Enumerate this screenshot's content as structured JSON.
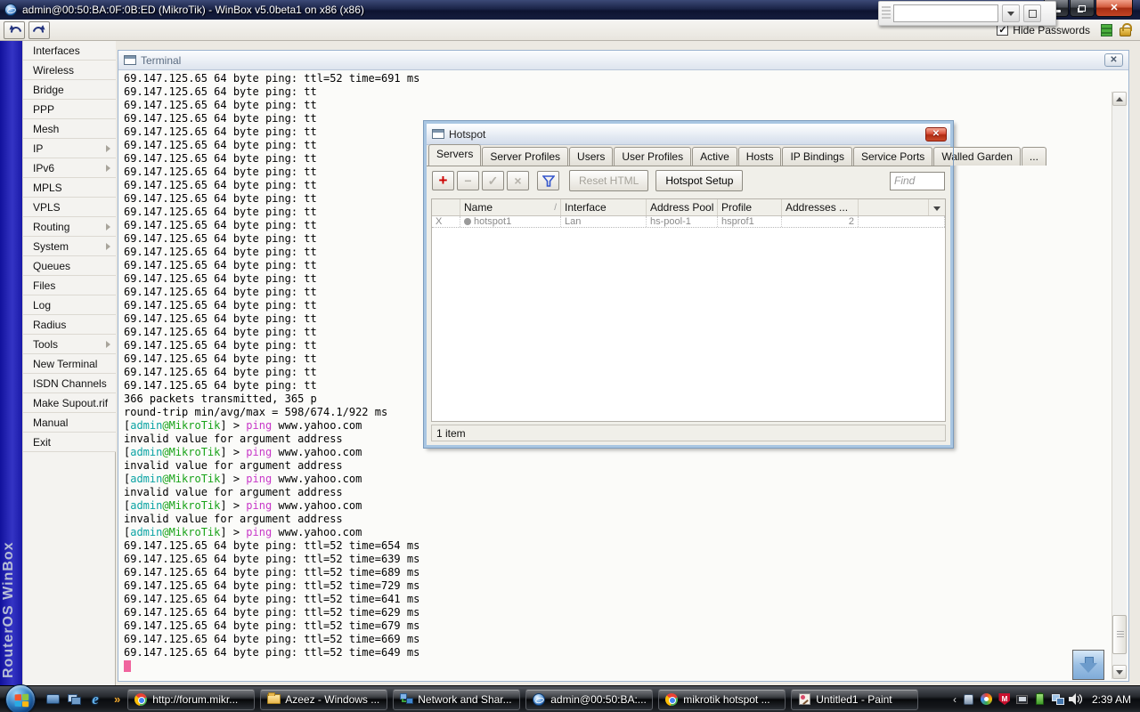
{
  "window": {
    "title": "admin@00:50:BA:0F:0B:ED (MikroTik) - WinBox v5.0beta1 on x86 (x86)"
  },
  "toolbar": {
    "hide_passwords_label": "Hide Passwords"
  },
  "sidebar": {
    "brand": "RouterOS WinBox",
    "items": [
      {
        "label": "Interfaces",
        "submenu": false
      },
      {
        "label": "Wireless",
        "submenu": false
      },
      {
        "label": "Bridge",
        "submenu": false
      },
      {
        "label": "PPP",
        "submenu": false
      },
      {
        "label": "Mesh",
        "submenu": false
      },
      {
        "label": "IP",
        "submenu": true
      },
      {
        "label": "IPv6",
        "submenu": true
      },
      {
        "label": "MPLS",
        "submenu": false
      },
      {
        "label": "VPLS",
        "submenu": false
      },
      {
        "label": "Routing",
        "submenu": true
      },
      {
        "label": "System",
        "submenu": true
      },
      {
        "label": "Queues",
        "submenu": false
      },
      {
        "label": "Files",
        "submenu": false
      },
      {
        "label": "Log",
        "submenu": false
      },
      {
        "label": "Radius",
        "submenu": false
      },
      {
        "label": "Tools",
        "submenu": true
      },
      {
        "label": "New Terminal",
        "submenu": false
      },
      {
        "label": "ISDN Channels",
        "submenu": false
      },
      {
        "label": "Make Supout.rif",
        "submenu": false
      },
      {
        "label": "Manual",
        "submenu": false
      },
      {
        "label": "Exit",
        "submenu": false
      }
    ]
  },
  "terminal": {
    "title": "Terminal",
    "prompt": {
      "open": "[",
      "user": "admin",
      "host": "@MikroTik",
      "close": "] > ",
      "command": "ping",
      "args": " www.yahoo.com"
    },
    "lines": [
      {
        "k": "plain",
        "text": "69.147.125.65 64 byte ping: ttl=52 time=691 ms"
      },
      {
        "k": "plain",
        "text": "69.147.125.65 64 byte ping: tt",
        "repeat": 23
      },
      {
        "k": "plain",
        "text": "366 packets transmitted, 365 p"
      },
      {
        "k": "plain",
        "text": "round-trip min/avg/max = 598/674.1/922 ms"
      },
      {
        "k": "prompt"
      },
      {
        "k": "plain",
        "text": "invalid value for argument address"
      },
      {
        "k": "prompt"
      },
      {
        "k": "plain",
        "text": "invalid value for argument address"
      },
      {
        "k": "prompt"
      },
      {
        "k": "plain",
        "text": "invalid value for argument address"
      },
      {
        "k": "prompt"
      },
      {
        "k": "plain",
        "text": "invalid value for argument address"
      },
      {
        "k": "prompt"
      },
      {
        "k": "plain",
        "text": "69.147.125.65 64 byte ping: ttl=52 time=654 ms"
      },
      {
        "k": "plain",
        "text": "69.147.125.65 64 byte ping: ttl=52 time=639 ms"
      },
      {
        "k": "plain",
        "text": "69.147.125.65 64 byte ping: ttl=52 time=689 ms"
      },
      {
        "k": "plain",
        "text": "69.147.125.65 64 byte ping: ttl=52 time=729 ms"
      },
      {
        "k": "plain",
        "text": "69.147.125.65 64 byte ping: ttl=52 time=641 ms"
      },
      {
        "k": "plain",
        "text": "69.147.125.65 64 byte ping: ttl=52 time=629 ms"
      },
      {
        "k": "plain",
        "text": "69.147.125.65 64 byte ping: ttl=52 time=679 ms"
      },
      {
        "k": "plain",
        "text": "69.147.125.65 64 byte ping: ttl=52 time=669 ms"
      },
      {
        "k": "plain",
        "text": "69.147.125.65 64 byte ping: ttl=52 time=649 ms"
      },
      {
        "k": "cursor"
      }
    ]
  },
  "hotspot_dialog": {
    "title": "Hotspot",
    "tabs": [
      "Servers",
      "Server Profiles",
      "Users",
      "User Profiles",
      "Active",
      "Hosts",
      "IP Bindings",
      "Service Ports",
      "Walled Garden",
      "..."
    ],
    "active_tab": "Servers",
    "toolbar": {
      "reset_html_label": "Reset HTML",
      "hotspot_setup_label": "Hotspot Setup",
      "find_placeholder": "Find"
    },
    "table": {
      "columns": [
        "",
        "Name",
        "Interface",
        "Address Pool",
        "Profile",
        "Addresses ..."
      ],
      "rows": [
        {
          "flag": "X",
          "name": "hotspot1",
          "interface": "Lan",
          "address_pool": "hs-pool-1",
          "profile": "hsprof1",
          "addresses": "2"
        }
      ]
    },
    "status": "1 item"
  },
  "taskbar": {
    "quick_launch": [
      "desktop",
      "switch",
      "ie"
    ],
    "overflow_chevron": "»",
    "buttons": [
      {
        "label": "http://forum.mikr...",
        "icon": "chrome"
      },
      {
        "label": "Azeez - Windows ...",
        "icon": "folder"
      },
      {
        "label": "Network and Shar...",
        "icon": "network"
      },
      {
        "label": "admin@00:50:BA:...",
        "icon": "winbox"
      },
      {
        "label": "mikrotik hotspot ...",
        "icon": "chrome"
      },
      {
        "label": "Untitled1 - Paint",
        "icon": "paint"
      }
    ],
    "tray_chevron": "‹",
    "tray_icons": [
      "gem",
      "swirl",
      "shield",
      "display"
    ],
    "status_icons": [
      "batt",
      "net2",
      "volume"
    ],
    "clock": "2:39 AM"
  },
  "colors": {
    "prompt_user": "#0aa3a3",
    "prompt_host": "#19a319",
    "prompt_command": "#c837c8",
    "cursor": "#f0649e",
    "close_button_red": "#b02c14",
    "brand_strip_blue": "#2a2ab8"
  }
}
